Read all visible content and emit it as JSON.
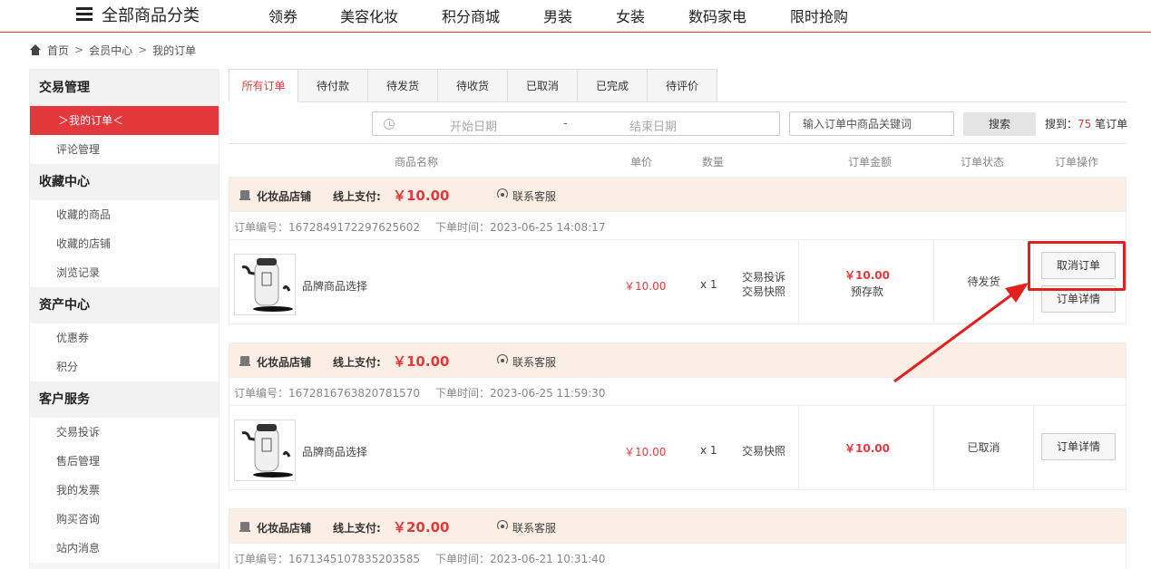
{
  "topnav": {
    "category_label": "全部商品分类",
    "links": [
      "领券",
      "美容化妆",
      "积分商城",
      "男装",
      "女装",
      "数码家电",
      "限时抢购"
    ]
  },
  "breadcrumb": {
    "home": "首页",
    "sep": ">",
    "level1": "会员中心",
    "level2": "我的订单"
  },
  "sidebar": {
    "sections": [
      {
        "title": "交易管理",
        "items": [
          "＞我的订单＜",
          "评论管理"
        ]
      },
      {
        "title": "收藏中心",
        "items": [
          "收藏的商品",
          "收藏的店铺",
          "浏览记录"
        ]
      },
      {
        "title": "资产中心",
        "items": [
          "优惠券",
          "积分"
        ]
      },
      {
        "title": "客户服务",
        "items": [
          "交易投诉",
          "售后管理",
          "我的发票",
          "购买咨询",
          "站内消息"
        ]
      }
    ]
  },
  "tabs": [
    "所有订单",
    "待付款",
    "待发货",
    "待收货",
    "已取消",
    "已完成",
    "待评价"
  ],
  "filters": {
    "start_placeholder": "开始日期",
    "dash": "-",
    "end_placeholder": "结束日期",
    "keyword_placeholder": "输入订单中商品关键词",
    "search_label": "搜索",
    "found_prefix": "搜到：",
    "found_count": "75",
    "found_suffix": " 笔订单"
  },
  "table_headers": {
    "name": "商品名称",
    "price": "单价",
    "qty": "数量",
    "amount": "订单金额",
    "status": "订单状态",
    "ops": "订单操作"
  },
  "orders": [
    {
      "shop": "化妆品店铺",
      "pay_label": "线上支付:",
      "pay_amount": "￥10.00",
      "service": "联系客服",
      "order_no": "订单编号：1672849172297625602",
      "order_time": "下单时间：2023-06-25 14:08:17",
      "product": "品牌商品选择",
      "price": "￥10.00",
      "qty": "x 1",
      "services": [
        "交易投诉",
        "交易快照"
      ],
      "amount": "￥10.00",
      "amount_note": "预存款",
      "status": "待发货",
      "buttons": [
        "取消订单",
        "订单详情"
      ]
    },
    {
      "shop": "化妆品店铺",
      "pay_label": "线上支付:",
      "pay_amount": "￥10.00",
      "service": "联系客服",
      "order_no": "订单编号：1672816763820781570",
      "order_time": "下单时间：2023-06-25 11:59:30",
      "product": "品牌商品选择",
      "price": "￥10.00",
      "qty": "x 1",
      "services": [
        "交易快照"
      ],
      "amount": "￥10.00",
      "amount_note": "",
      "status": "已取消",
      "buttons": [
        "订单详情"
      ]
    },
    {
      "shop": "化妆品店铺",
      "pay_label": "线上支付:",
      "pay_amount": "￥20.00",
      "service": "联系客服",
      "order_no": "订单编号：1671345107835203585",
      "order_time": "下单时间：2023-06-21 10:31:40"
    }
  ],
  "colors": {
    "accent": "#e4393c",
    "order_header_bg": "#fbeee5",
    "annotation": "#e32020"
  }
}
